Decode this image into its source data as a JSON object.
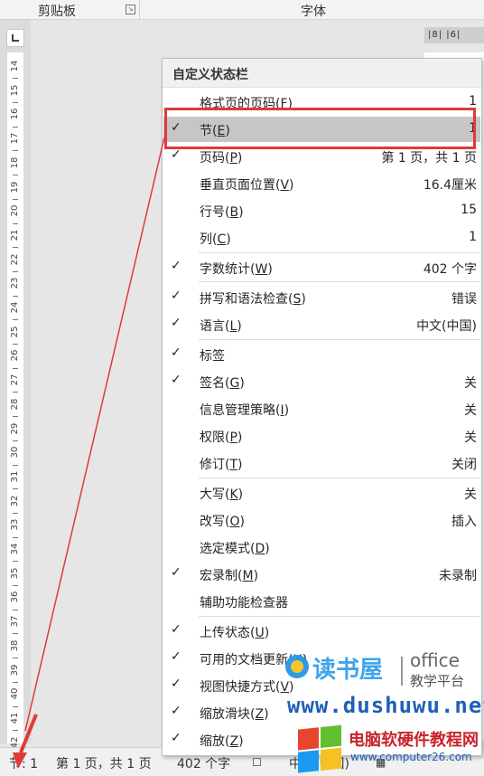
{
  "ribbon": {
    "clipboard_group": "剪贴板",
    "font_group": "字体"
  },
  "ruler": {
    "numbers": [
      "14",
      "15",
      "16",
      "17",
      "18",
      "19",
      "20",
      "21",
      "22",
      "23",
      "24",
      "25",
      "26",
      "27",
      "28",
      "29",
      "30",
      "31",
      "32",
      "33",
      "34",
      "35",
      "36",
      "37",
      "38",
      "39",
      "40",
      "41",
      "42"
    ],
    "top_marks": "|8| |6|"
  },
  "menu": {
    "title": "自定义状态栏",
    "items": [
      {
        "checked": false,
        "text": "格式页的页码",
        "accel": "F",
        "value": "1"
      },
      {
        "checked": true,
        "text": "节",
        "accel": "E",
        "value": "1",
        "highlight": true
      },
      {
        "checked": true,
        "text": "页码",
        "accel": "P",
        "value": "第 1 页，共 1 页"
      },
      {
        "checked": false,
        "text": "垂直页面位置",
        "accel": "V",
        "value": "16.4厘米"
      },
      {
        "checked": false,
        "text": "行号",
        "accel": "B",
        "value": "15"
      },
      {
        "checked": false,
        "text": "列",
        "accel": "C",
        "value": "1"
      },
      {
        "checked": true,
        "text": "字数统计",
        "accel": "W",
        "value": "402 个字"
      },
      {
        "checked": true,
        "text": "拼写和语法检查",
        "accel": "S",
        "value": "错误"
      },
      {
        "checked": true,
        "text": "语言",
        "accel": "L",
        "value": "中文(中国)"
      },
      {
        "checked": true,
        "text": "标签",
        "accel": "",
        "value": ""
      },
      {
        "checked": true,
        "text": "签名",
        "accel": "G",
        "value": "关"
      },
      {
        "checked": false,
        "text": "信息管理策略",
        "accel": "I",
        "value": "关"
      },
      {
        "checked": false,
        "text": "权限",
        "accel": "P",
        "value": "关"
      },
      {
        "checked": false,
        "text": "修订",
        "accel": "T",
        "value": "关闭"
      },
      {
        "checked": false,
        "text": "大写",
        "accel": "K",
        "value": "关"
      },
      {
        "checked": false,
        "text": "改写",
        "accel": "O",
        "value": "插入"
      },
      {
        "checked": false,
        "text": "选定模式",
        "accel": "D",
        "value": ""
      },
      {
        "checked": true,
        "text": "宏录制",
        "accel": "M",
        "value": "未录制"
      },
      {
        "checked": false,
        "text": "辅助功能检查器",
        "accel": "",
        "value": ""
      },
      {
        "checked": true,
        "text": "上传状态",
        "accel": "U",
        "value": ""
      },
      {
        "checked": true,
        "text": "可用的文档更新",
        "accel": "U",
        "value": ""
      },
      {
        "checked": true,
        "text": "视图快捷方式",
        "accel": "V",
        "value": ""
      },
      {
        "checked": true,
        "text": "缩放滑块",
        "accel": "Z",
        "value": ""
      },
      {
        "checked": true,
        "text": "缩放",
        "accel": "Z",
        "value": ""
      }
    ]
  },
  "statusbar": {
    "section": "节: 1",
    "page": "第 1 页，共 1 页",
    "words": "402 个字",
    "language": "中文(中国)"
  },
  "watermarks": {
    "dushuwu_name": "读书屋",
    "office_word": "office",
    "office_sub": "教学平台",
    "dushuwu_url": "www.dushuwu.net",
    "site_name": "电脑软硬件教程网",
    "site_url": "www.computer26.com"
  },
  "colors": {
    "highlight_bg": "#c6c6c6",
    "annotation_red": "#e03a3a"
  }
}
